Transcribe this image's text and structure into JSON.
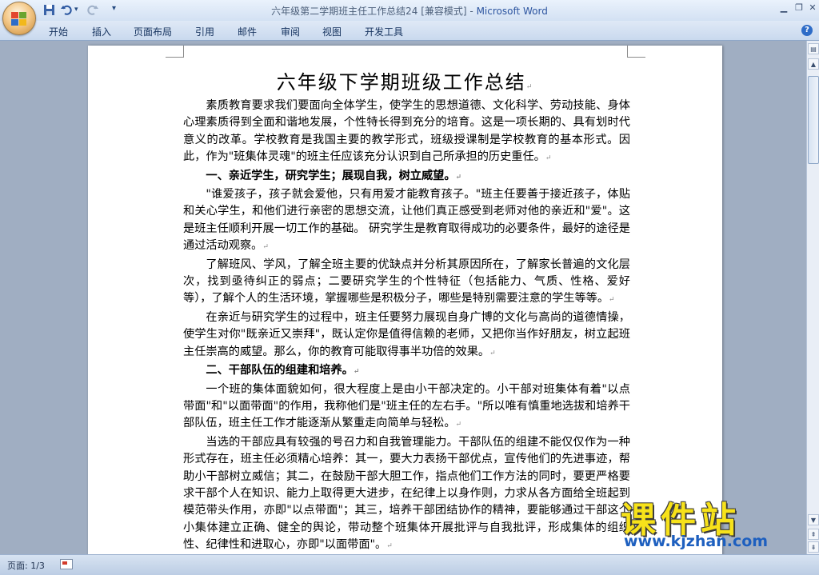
{
  "window": {
    "title_doc": "六年级第二学期班主任工作总结24 [兼容模式] - ",
    "title_app": "Microsoft Word"
  },
  "quick_access": {
    "save": "save-icon",
    "undo": "undo-icon",
    "redo": "redo-icon",
    "customize": "▾"
  },
  "ribbon": {
    "tabs": [
      "开始",
      "插入",
      "页面布局",
      "引用",
      "邮件",
      "审阅",
      "视图",
      "开发工具"
    ],
    "help": "?"
  },
  "document": {
    "title": "六年级下学期班级工作总结",
    "paragraphs": [
      {
        "type": "p",
        "text": "素质教育要求我们要面向全体学生，使学生的思想道德、文化科学、劳动技能、身体心理素质得到全面和谐地发展，个性特长得到充分的培育。这是一项长期的、具有划时代意义的改革。学校教育是我国主要的教学形式，班级授课制是学校教育的基本形式。因此，作为\"班集体灵魂\"的班主任应该充分认识到自己所承担的历史重任。"
      },
      {
        "type": "h",
        "text": "一、亲近学生，研究学生；展现自我，树立威望。"
      },
      {
        "type": "p",
        "text": "\"谁爱孩子，孩子就会爱他，只有用爱才能教育孩子。\"班主任要善于接近孩子，体贴和关心学生，和他们进行亲密的思想交流，让他们真正感受到老师对他的亲近和\"爱\"。这是班主任顺利开展一切工作的基础。  研究学生是教育取得成功的必要条件，最好的途径是通过活动观察。"
      },
      {
        "type": "p",
        "text": "了解班风、学风，了解全班主要的优缺点并分析其原因所在，了解家长普遍的文化层次，找到亟待纠正的弱点；二要研究学生的个性特征（包括能力、气质、性格、爱好等），了解个人的生活环境，掌握哪些是积极分子，哪些是特别需要注意的学生等等。"
      },
      {
        "type": "p",
        "text": "在亲近与研究学生的过程中，班主任要努力展现自身广博的文化与高尚的道德情操，使学生对你\"既亲近又崇拜\"，既认定你是值得信赖的老师，又把你当作好朋友，树立起班主任崇高的威望。那么，你的教育可能取得事半功倍的效果。"
      },
      {
        "type": "h",
        "text": "二、干部队伍的组建和培养。"
      },
      {
        "type": "p",
        "text": "一个班的集体面貌如何，很大程度上是由小干部决定的。小干部对班集体有着\"以点带面\"和\"以面带面\"的作用，我称他们是\"班主任的左右手。\"所以唯有慎重地选拔和培养干部队伍，班主任工作才能逐渐从繁重走向简单与轻松。"
      },
      {
        "type": "p",
        "text": "当选的干部应具有较强的号召力和自我管理能力。干部队伍的组建不能仅仅作为一种形式存在，班主任必须精心培养：其一，要大力表扬干部优点，宣传他们的先进事迹，帮助小干部树立威信；其二，在鼓励干部大胆工作，指点他们工作方法的同时，要更严格要求干部个人在知识、能力上取得更大进步，在纪律上以身作则，力求从各方面给全班起到模范带头作用，亦即\"以点带面\"；其三，培养干部团结协作的精神，要能够通过干部这个小集体建立正确、健全的舆论，带动整个班集体开展批评与自我批评，形成集体的组织性、纪律性和进取心，亦即\"以面带面\"。"
      }
    ]
  },
  "statusbar": {
    "page": "页面: 1/3"
  },
  "watermark": {
    "text": "课件站",
    "url": "www.kjzhan.com"
  }
}
